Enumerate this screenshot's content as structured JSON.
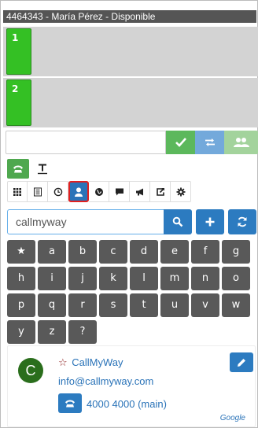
{
  "status_bar": {
    "text": "4464343 - María Pérez - Disponible"
  },
  "lines": [
    {
      "number": "1"
    },
    {
      "number": "2"
    }
  ],
  "dial": {
    "value": "",
    "placeholder": "",
    "accept_icon": "check-icon",
    "transfer_icon": "transfer-arrows-icon",
    "conference_icon": "users-icon"
  },
  "modes": [
    {
      "icon": "phone-icon",
      "selected": true
    },
    {
      "icon": "text-t-icon",
      "selected": false
    }
  ],
  "tabs": [
    {
      "icon": "grid-icon"
    },
    {
      "icon": "list-icon"
    },
    {
      "icon": "clock-icon"
    },
    {
      "icon": "user-icon",
      "active": true
    },
    {
      "icon": "globe-icon"
    },
    {
      "icon": "comment-icon"
    },
    {
      "icon": "megaphone-icon"
    },
    {
      "icon": "share-icon"
    },
    {
      "icon": "gear-icon"
    }
  ],
  "search": {
    "value": "callmyway",
    "search_icon": "search-icon",
    "add_icon": "plus-icon",
    "refresh_icon": "refresh-icon"
  },
  "keypad": {
    "rows": [
      [
        "★",
        "a",
        "b",
        "c",
        "d",
        "e",
        "f",
        "g"
      ],
      [
        "h",
        "i",
        "j",
        "k",
        "l",
        "m",
        "n",
        "o"
      ],
      [
        "p",
        "q",
        "r",
        "s",
        "t",
        "u",
        "v",
        "w"
      ],
      [
        "y",
        "z",
        "?"
      ]
    ]
  },
  "contact": {
    "initial": "C",
    "star": "☆",
    "name": "CallMyWay",
    "email": "info@callmyway.com",
    "phone": "4000 4000 (main)",
    "source": "Google"
  },
  "colors": {
    "line_active": "#34c024",
    "primary": "#2c7bc0",
    "success": "#5cb85c",
    "avatar": "#2a6e1c",
    "key": "#595959",
    "status_bar": "#555555"
  }
}
